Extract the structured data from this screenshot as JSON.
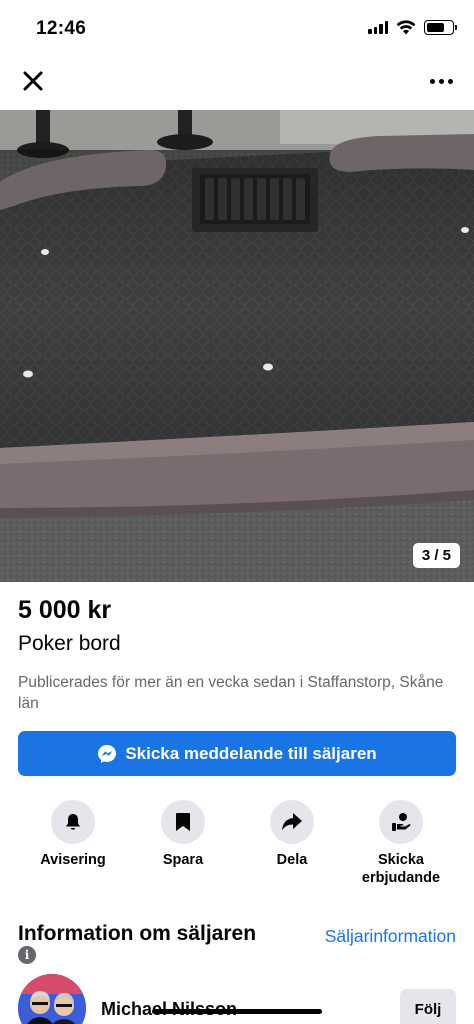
{
  "status_bar": {
    "time": "12:46",
    "icons": [
      "cellular-signal-icon",
      "wifi-icon",
      "battery-icon"
    ]
  },
  "nav": {
    "icons": [
      "close-icon",
      "more-icon"
    ]
  },
  "photo": {
    "counter": "3 / 5"
  },
  "listing": {
    "price": "5 000 kr",
    "title": "Poker bord",
    "meta": "Publicerades för mer än en vecka sedan i Staffanstorp, Skåne län"
  },
  "message_button": {
    "label": "Skicka meddelande till säljaren",
    "color": "#1b74e4"
  },
  "actions": [
    {
      "label": "Avisering",
      "icon": "bell-icon"
    },
    {
      "label": "Spara",
      "icon": "bookmark-icon"
    },
    {
      "label": "Dela",
      "icon": "share-icon"
    },
    {
      "label": "Skicka erbjudande",
      "icon": "offer-icon"
    }
  ],
  "seller": {
    "heading": "Information om säljaren",
    "details_link": "Säljarinformation",
    "name": "Michael Nilsson",
    "follow": "Följ"
  }
}
